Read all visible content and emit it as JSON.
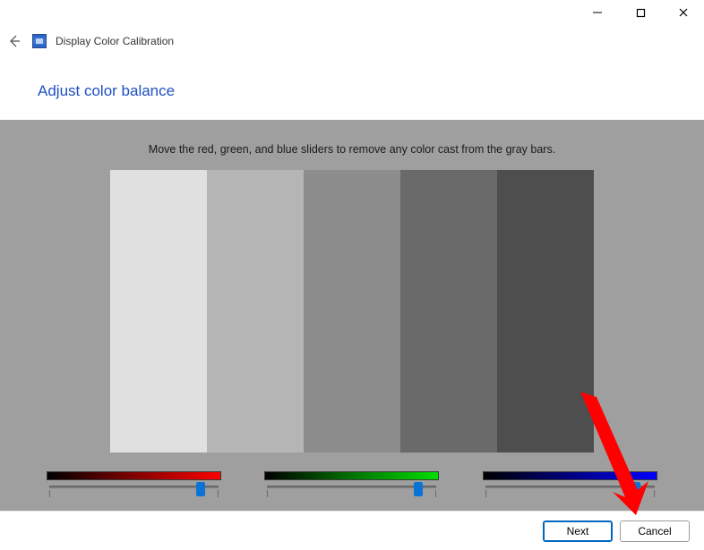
{
  "window": {
    "title": "Display Color Calibration"
  },
  "page": {
    "heading": "Adjust color balance",
    "instruction": "Move the red, green, and blue sliders to remove any color cast from the gray bars."
  },
  "gray_bars": [
    {
      "color": "#e0e0e0"
    },
    {
      "color": "#b5b5b5"
    },
    {
      "color": "#8d8d8d"
    },
    {
      "color": "#6a6a6a"
    },
    {
      "color": "#4e4e4e"
    }
  ],
  "sliders": {
    "red": {
      "value_percent": 88
    },
    "green": {
      "value_percent": 88
    },
    "blue": {
      "value_percent": 88
    }
  },
  "buttons": {
    "next": "Next",
    "cancel": "Cancel"
  }
}
